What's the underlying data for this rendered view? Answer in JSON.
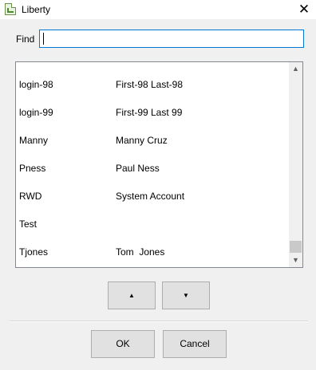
{
  "window": {
    "title": "Liberty",
    "icon": "document-check-icon",
    "close_symbol": "✕"
  },
  "find": {
    "label": "Find",
    "value": ""
  },
  "list": {
    "rows": [
      {
        "login": "login-98",
        "name": "First-98 Last-98"
      },
      {
        "login": "login-99",
        "name": "First-99 Last 99"
      },
      {
        "login": "Manny",
        "name": "Manny Cruz"
      },
      {
        "login": "Pness",
        "name": "Paul Ness"
      },
      {
        "login": "RWD",
        "name": "System Account"
      },
      {
        "login": "Test",
        "name": ""
      },
      {
        "login": "Tjones",
        "name": "Tom  Jones"
      }
    ],
    "scroll_up_symbol": "▲",
    "scroll_down_symbol": "▼"
  },
  "nav": {
    "up_symbol": "▲",
    "down_symbol": "▼"
  },
  "buttons": {
    "ok": "OK",
    "cancel": "Cancel"
  }
}
